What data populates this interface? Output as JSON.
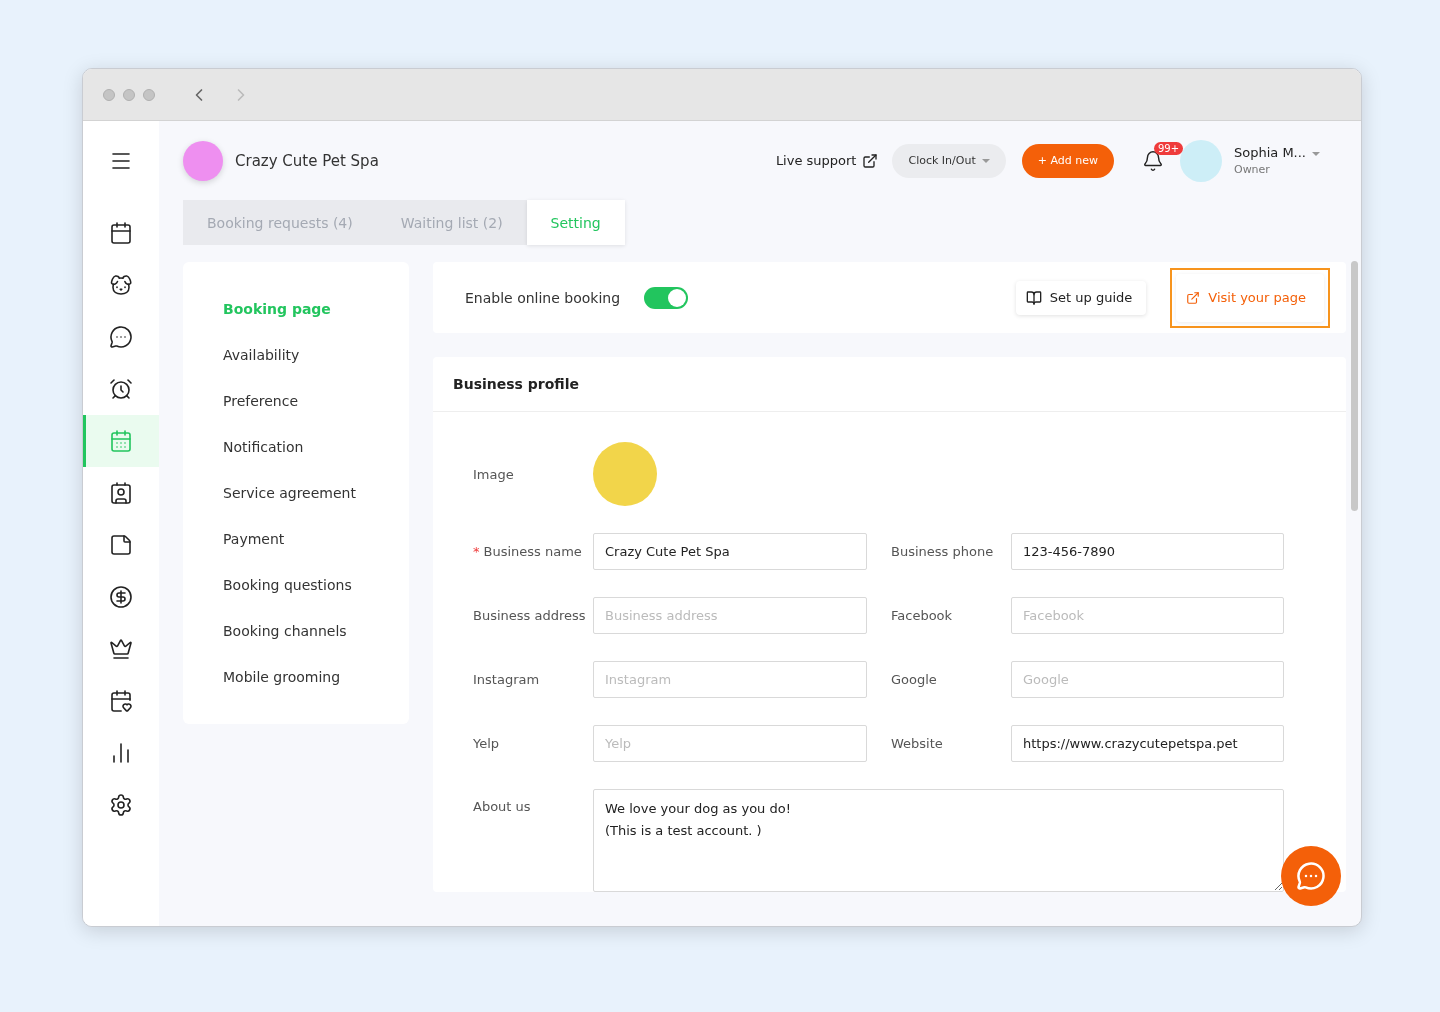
{
  "sidebar": {
    "items": [
      {
        "kind": "menu",
        "selected": false
      },
      {
        "kind": "calendar",
        "selected": false
      },
      {
        "kind": "dog",
        "selected": false
      },
      {
        "kind": "chat",
        "selected": false
      },
      {
        "kind": "alarm",
        "selected": false
      },
      {
        "kind": "booking",
        "selected": true
      },
      {
        "kind": "badge",
        "selected": false
      },
      {
        "kind": "note",
        "selected": false
      },
      {
        "kind": "dollar",
        "selected": false
      },
      {
        "kind": "crown",
        "selected": false
      },
      {
        "kind": "heart-calendar",
        "selected": false
      },
      {
        "kind": "chart",
        "selected": false
      },
      {
        "kind": "settings",
        "selected": false
      }
    ]
  },
  "header": {
    "business_name": "Crazy Cute Pet Spa",
    "live_support": "Live support",
    "clock": "Clock In/Out",
    "add_new": "+ Add new",
    "notifications": "99+",
    "user_name": "Sophia M...",
    "user_role": "Owner"
  },
  "tabs": [
    {
      "label": "Booking requests (4)",
      "selected": false
    },
    {
      "label": "Waiting list (2)",
      "selected": false
    },
    {
      "label": "Setting",
      "selected": true
    }
  ],
  "settings_menu": [
    {
      "label": "Booking page",
      "selected": true
    },
    {
      "label": "Availability",
      "selected": false
    },
    {
      "label": "Preference",
      "selected": false
    },
    {
      "label": "Notification",
      "selected": false
    },
    {
      "label": "Service agreement",
      "selected": false
    },
    {
      "label": "Payment",
      "selected": false
    },
    {
      "label": "Booking questions",
      "selected": false
    },
    {
      "label": "Booking channels",
      "selected": false
    },
    {
      "label": "Mobile grooming",
      "selected": false
    }
  ],
  "online_booking": {
    "label": "Enable online booking",
    "on": true,
    "guide": "Set up guide",
    "visit": "Visit your page",
    "visit_highlighted": true
  },
  "profile": {
    "title": "Business profile",
    "image_label": "Image",
    "fields": [
      {
        "label": "Business name",
        "required_mark": "*",
        "value": "Crazy Cute Pet Spa"
      },
      {
        "label": "Business phone",
        "value": "123-456-7890"
      },
      {
        "label": "Business address",
        "placeholder": "Business address"
      },
      {
        "label": "Facebook",
        "placeholder": "Facebook"
      },
      {
        "label": "Instagram",
        "placeholder": "Instagram"
      },
      {
        "label": "Google",
        "placeholder": "Google"
      },
      {
        "label": "Yelp",
        "placeholder": "Yelp"
      },
      {
        "label": "Website",
        "value": "https://www.crazycutepetspa.pet"
      }
    ],
    "about": {
      "label": "About us",
      "value": "We love your dog as you do!\n(This is a test account. )"
    }
  }
}
